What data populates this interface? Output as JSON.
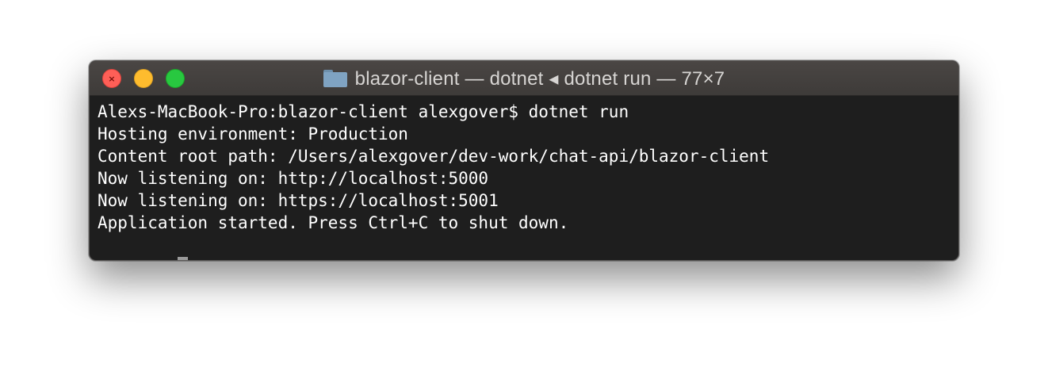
{
  "window": {
    "title": "blazor-client — dotnet ◂ dotnet run — 77×7"
  },
  "title_icon": "folder-icon",
  "traffic_lights": {
    "close_color": "#fe5f57",
    "minimize_color": "#febc2e",
    "maximize_color": "#28c840"
  },
  "terminal": {
    "lines": [
      "Alexs-MacBook-Pro:blazor-client alexgover$ dotnet run",
      "Hosting environment: Production",
      "Content root path: /Users/alexgover/dev-work/chat-api/blazor-client",
      "Now listening on: http://localhost:5000",
      "Now listening on: https://localhost:5001",
      "Application started. Press Ctrl+C to shut down."
    ]
  }
}
